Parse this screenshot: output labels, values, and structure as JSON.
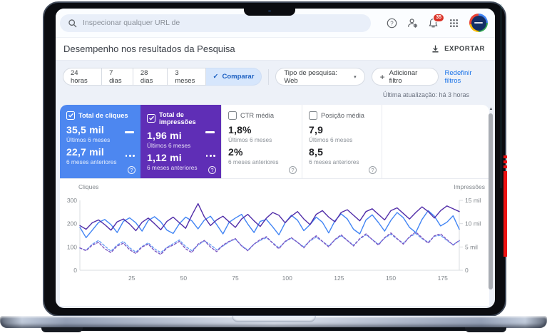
{
  "topbar": {
    "search_placeholder": "Inspecionar qualquer URL de",
    "notification_count": "35"
  },
  "title_row": {
    "title": "Desempenho nos resultados da Pesquisa",
    "export_label": "EXPORTAR"
  },
  "filters": {
    "ranges": [
      {
        "label": "24 horas"
      },
      {
        "label": "7 dias"
      },
      {
        "label": "28 dias"
      },
      {
        "label": "3 meses"
      }
    ],
    "compare_label": "Comparar",
    "search_type_label": "Tipo de pesquisa: Web",
    "add_filter_label": "Adicionar filtro",
    "reset_label": "Redefinir filtros",
    "last_update": "Última atualização: há 3 horas"
  },
  "periods": {
    "current": "Últimos 6 meses",
    "previous": "6 meses anteriores"
  },
  "cards": [
    {
      "label": "Total de cliques",
      "checked": true,
      "value_current": "35,5 mil",
      "value_previous": "22,7 mil"
    },
    {
      "label": "Total de impressões",
      "checked": true,
      "value_current": "1,96 mi",
      "value_previous": "1,12 mi"
    },
    {
      "label": "CTR média",
      "checked": false,
      "value_current": "1,8%",
      "value_previous": "2%"
    },
    {
      "label": "Posição média",
      "checked": false,
      "value_current": "7,9",
      "value_previous": "8,5"
    }
  ],
  "glyphs": {
    "help": "?",
    "caret": "▾",
    "check": "✓",
    "plus": "+",
    "scroll_up": "▲"
  },
  "colors": {
    "clicks_card": "#4d87f0",
    "impressions_card": "#5f2eb6",
    "compare_chip_bg": "#d6e6fc",
    "link_blue": "#1a73e8",
    "badge_red": "#d93025",
    "laptop_red_stripe": "#ee1212"
  },
  "chart_data": {
    "type": "line",
    "x_domain": [
      0,
      183
    ],
    "x_step": 3,
    "x_ticks": [
      25,
      50,
      75,
      100,
      125,
      150,
      175
    ],
    "left_axis": {
      "label": "Cliques",
      "lim": [
        0,
        300
      ],
      "tick_values": [
        300,
        200,
        100,
        0
      ],
      "tick_labels": [
        "300",
        "200",
        "100",
        "0"
      ]
    },
    "right_axis": {
      "label": "Impressões",
      "lim": [
        0,
        15000
      ],
      "tick_values": [
        15000,
        10000,
        5000,
        0
      ],
      "tick_labels": [
        "15 mil",
        "10 mil",
        "5 mil",
        "0"
      ]
    },
    "grid": false,
    "series": [
      {
        "name": "Cliques — Últimos 6 meses",
        "axis": "left",
        "style": "solid",
        "color": "#4285f4",
        "values": [
          185,
          140,
          172,
          205,
          218,
          196,
          162,
          210,
          225,
          204,
          168,
          214,
          230,
          208,
          172,
          158,
          200,
          228,
          212,
          178,
          215,
          232,
          196,
          156,
          206,
          224,
          240,
          198,
          162,
          210,
          218,
          186,
          152,
          204,
          236,
          215,
          170,
          196,
          228,
          206,
          160,
          212,
          242,
          220,
          176,
          156,
          216,
          238,
          205,
          168,
          214,
          248,
          226,
          184,
          162,
          218,
          256,
          232,
          190,
          206,
          234,
          176
        ]
      },
      {
        "name": "Cliques — 6 meses anteriores",
        "axis": "left",
        "style": "dashed",
        "color": "#6ba0f7",
        "values": [
          95,
          86,
          112,
          128,
          104,
          82,
          108,
          124,
          96,
          78,
          102,
          118,
          92,
          76,
          98,
          114,
          130,
          102,
          84,
          108,
          126,
          110,
          88,
          104,
          122,
          134,
          106,
          86,
          112,
          128,
          140,
          118,
          96,
          122,
          138,
          120,
          100,
          126,
          142,
          124,
          104,
          130,
          148,
          128,
          108,
          134,
          152,
          132,
          112,
          138,
          155,
          134,
          116,
          142,
          158,
          136,
          120,
          146,
          150,
          128,
          110,
          126
        ]
      },
      {
        "name": "Impressões — Últimos 6 meses",
        "axis": "right",
        "style": "solid",
        "color": "#512da8",
        "values": [
          9600,
          8800,
          10200,
          10800,
          9800,
          8600,
          10400,
          11000,
          9900,
          8500,
          10300,
          11200,
          10000,
          8700,
          10500,
          11400,
          10200,
          9000,
          11800,
          14300,
          11500,
          9600,
          10800,
          11600,
          10400,
          9200,
          11000,
          12000,
          10600,
          9400,
          11200,
          12400,
          11800,
          10200,
          11600,
          12600,
          11000,
          9800,
          12000,
          12800,
          11400,
          10400,
          12400,
          13000,
          11800,
          10600,
          12600,
          13200,
          12000,
          10800,
          12800,
          13400,
          12200,
          11000,
          12400,
          13600,
          12600,
          11200,
          12800,
          13800,
          13200,
          12600
        ]
      },
      {
        "name": "Impressões — 6 meses anteriores",
        "axis": "right",
        "style": "dashed",
        "color": "#7e57c2",
        "values": [
          4800,
          4200,
          5400,
          6000,
          4600,
          3800,
          5200,
          5800,
          4400,
          3600,
          5000,
          5600,
          4200,
          3400,
          4800,
          5400,
          6200,
          4600,
          3800,
          5600,
          6400,
          5000,
          4000,
          5400,
          6200,
          6800,
          5200,
          4200,
          5600,
          6600,
          7200,
          5800,
          4600,
          6200,
          7000,
          6000,
          4800,
          6400,
          7400,
          6200,
          5000,
          6600,
          7600,
          6400,
          5200,
          6800,
          7800,
          6600,
          5400,
          7000,
          8000,
          6800,
          5600,
          7200,
          8200,
          7000,
          5800,
          7400,
          7800,
          6600,
          5400,
          6400
        ]
      }
    ]
  }
}
